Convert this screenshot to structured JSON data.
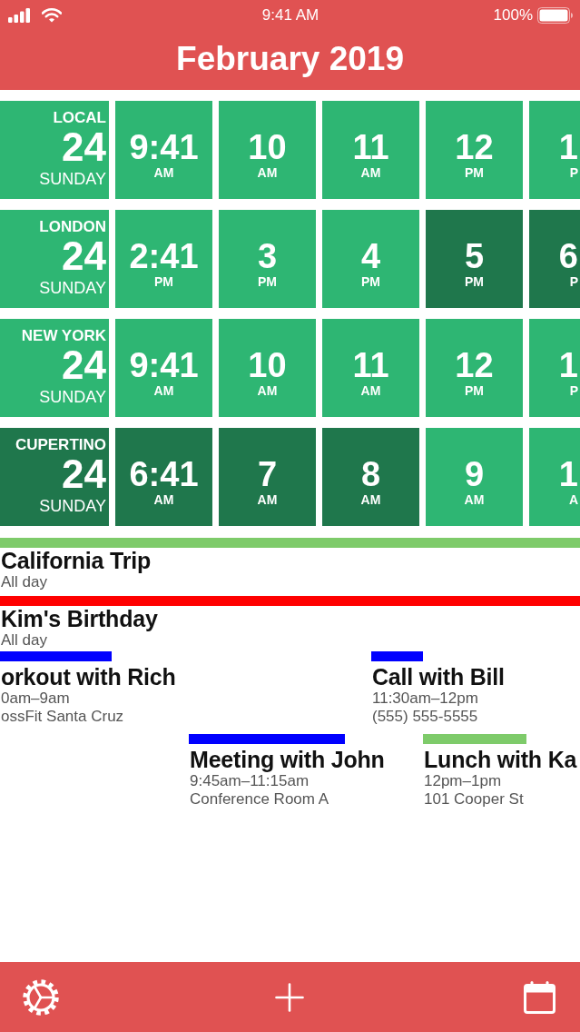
{
  "status_bar": {
    "time": "9:41 AM",
    "battery": "100%"
  },
  "header": {
    "title": "February 2019"
  },
  "zones": [
    {
      "city": "LOCAL",
      "day": "24",
      "weekday": "SUNDAY",
      "off_hours": false,
      "hours": [
        {
          "time": "9:41",
          "period": "AM",
          "off_hours": false
        },
        {
          "time": "10",
          "period": "AM",
          "off_hours": false
        },
        {
          "time": "11",
          "period": "AM",
          "off_hours": false
        },
        {
          "time": "12",
          "period": "PM",
          "off_hours": false
        },
        {
          "time": "1",
          "period": "P",
          "off_hours": false
        }
      ]
    },
    {
      "city": "LONDON",
      "day": "24",
      "weekday": "SUNDAY",
      "off_hours": false,
      "hours": [
        {
          "time": "2:41",
          "period": "PM",
          "off_hours": false
        },
        {
          "time": "3",
          "period": "PM",
          "off_hours": false
        },
        {
          "time": "4",
          "period": "PM",
          "off_hours": false
        },
        {
          "time": "5",
          "period": "PM",
          "off_hours": true
        },
        {
          "time": "6",
          "period": "P",
          "off_hours": true
        }
      ]
    },
    {
      "city": "NEW YORK",
      "day": "24",
      "weekday": "SUNDAY",
      "off_hours": false,
      "hours": [
        {
          "time": "9:41",
          "period": "AM",
          "off_hours": false
        },
        {
          "time": "10",
          "period": "AM",
          "off_hours": false
        },
        {
          "time": "11",
          "period": "AM",
          "off_hours": false
        },
        {
          "time": "12",
          "period": "PM",
          "off_hours": false
        },
        {
          "time": "1",
          "period": "P",
          "off_hours": false
        }
      ]
    },
    {
      "city": "CUPERTINO",
      "day": "24",
      "weekday": "SUNDAY",
      "off_hours": true,
      "hours": [
        {
          "time": "6:41",
          "period": "AM",
          "off_hours": true
        },
        {
          "time": "7",
          "period": "AM",
          "off_hours": true
        },
        {
          "time": "8",
          "period": "AM",
          "off_hours": true
        },
        {
          "time": "9",
          "period": "AM",
          "off_hours": false
        },
        {
          "time": "1",
          "period": "A",
          "off_hours": false
        }
      ]
    }
  ],
  "all_day_events": [
    {
      "title": "California Trip",
      "time": "All day",
      "color": "#7ECB6A"
    },
    {
      "title": "Kim's Birthday",
      "time": "All day",
      "color": "#FF0000"
    }
  ],
  "timed_events": [
    {
      "title": "orkout with Rich",
      "time": "0am–9am",
      "location": "ossFit Santa Cruz",
      "color": "#0000FF"
    },
    {
      "title": "Call with Bill",
      "time": "11:30am–12pm",
      "location": "(555) 555-5555",
      "color": "#0000FF"
    },
    {
      "title": "Meeting with John",
      "time": "9:45am–11:15am",
      "location": "Conference Room A",
      "color": "#0000FF"
    },
    {
      "title": "Lunch with Ka",
      "time": "12pm–1pm",
      "location": "101 Cooper St",
      "color": "#7ECB6A"
    }
  ]
}
